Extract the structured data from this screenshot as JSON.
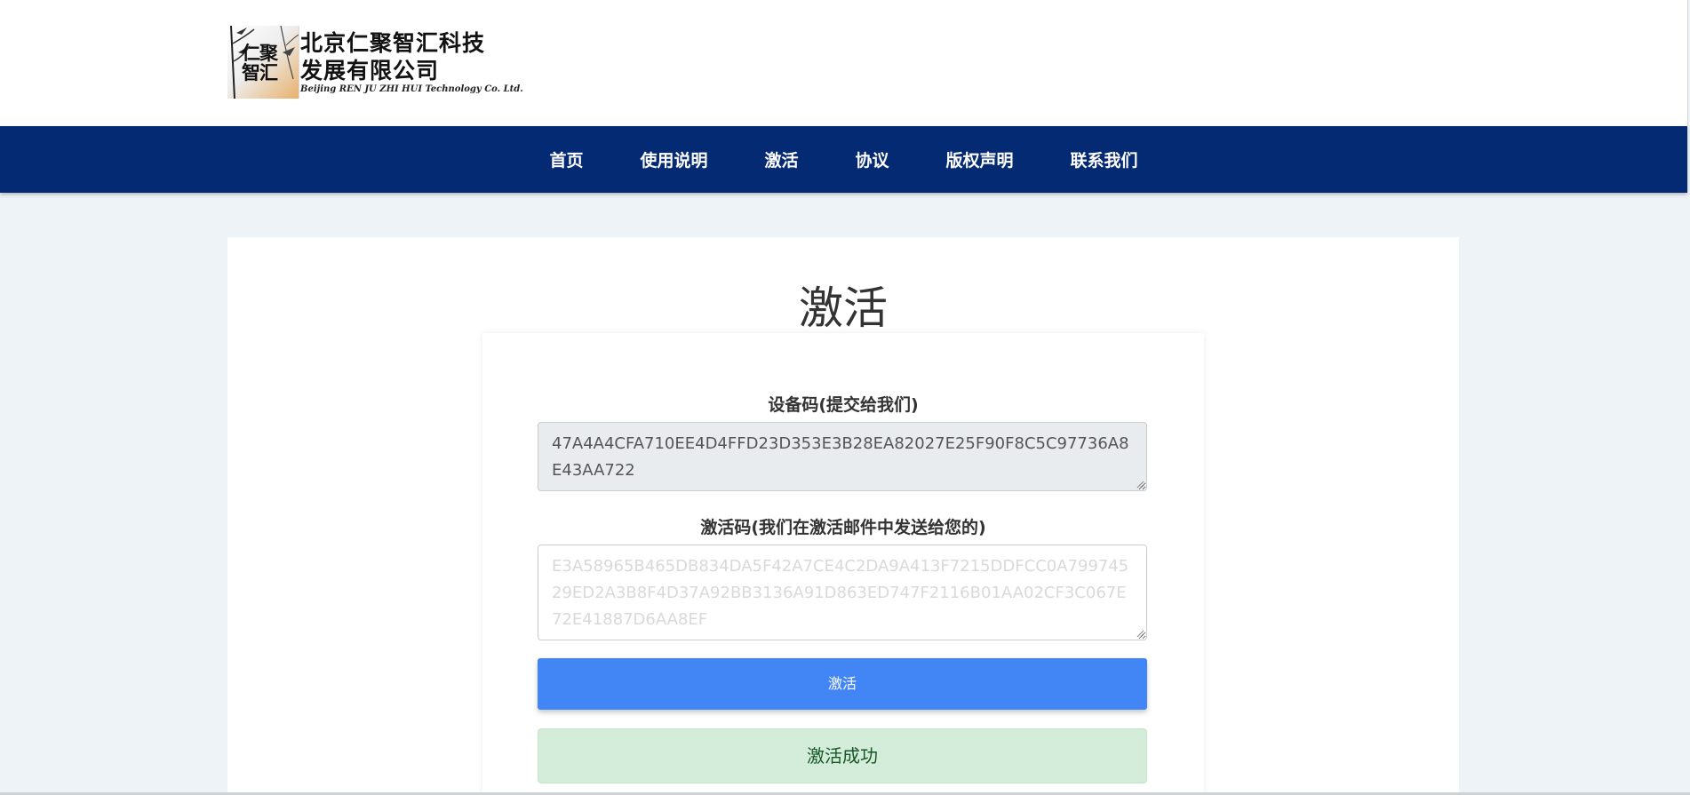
{
  "logo": {
    "seal_text": "仁聚\n智汇",
    "name_line1": "北京仁聚智汇科技",
    "name_line2": "发展有限公司",
    "name_en": "Beijing REN JU ZHI HUI Technology Co. Ltd."
  },
  "nav": {
    "items": [
      {
        "label": "首页"
      },
      {
        "label": "使用说明"
      },
      {
        "label": "激活"
      },
      {
        "label": "协议"
      },
      {
        "label": "版权声明"
      },
      {
        "label": "联系我们"
      }
    ]
  },
  "main": {
    "title": "激活",
    "device_code": {
      "label": "设备码(提交给我们)",
      "value": "47A4A4CFA710EE4D4FFD23D353E3B28EA82027E25F90F8C5C97736A8E43AA722"
    },
    "activation_code": {
      "label": "激活码(我们在激活邮件中发送给您的)",
      "value": "E3A58965B465DB834DA5F42A7CE4C2DA9A413F7215DDFCC0A79974529ED2A3B8F4D37A92BB3136A91D863ED747F2116B01AA02CF3C067E72E41887D6AA8EF"
    },
    "activate_button": "激活",
    "success_message": "激活成功"
  },
  "colors": {
    "nav_bg": "#052a74",
    "button_bg": "#4285f4",
    "success_bg": "#d4edda",
    "success_text": "#155724",
    "page_bg": "#eef3f7"
  }
}
